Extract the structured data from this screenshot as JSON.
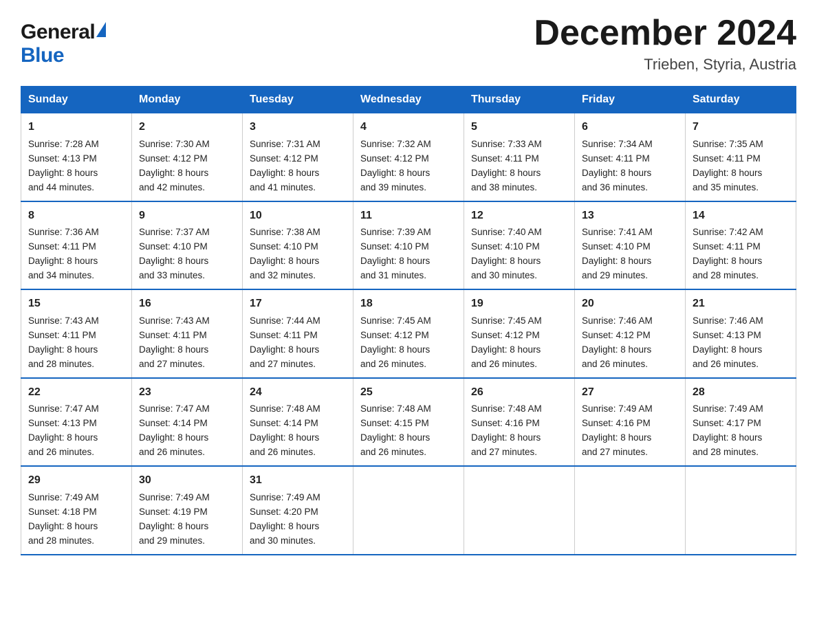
{
  "header": {
    "logo_line1": "General",
    "logo_line2": "Blue",
    "month_title": "December 2024",
    "location": "Trieben, Styria, Austria"
  },
  "days_of_week": [
    "Sunday",
    "Monday",
    "Tuesday",
    "Wednesday",
    "Thursday",
    "Friday",
    "Saturday"
  ],
  "weeks": [
    [
      {
        "day": "1",
        "sunrise": "7:28 AM",
        "sunset": "4:13 PM",
        "daylight": "8 hours and 44 minutes."
      },
      {
        "day": "2",
        "sunrise": "7:30 AM",
        "sunset": "4:12 PM",
        "daylight": "8 hours and 42 minutes."
      },
      {
        "day": "3",
        "sunrise": "7:31 AM",
        "sunset": "4:12 PM",
        "daylight": "8 hours and 41 minutes."
      },
      {
        "day": "4",
        "sunrise": "7:32 AM",
        "sunset": "4:12 PM",
        "daylight": "8 hours and 39 minutes."
      },
      {
        "day": "5",
        "sunrise": "7:33 AM",
        "sunset": "4:11 PM",
        "daylight": "8 hours and 38 minutes."
      },
      {
        "day": "6",
        "sunrise": "7:34 AM",
        "sunset": "4:11 PM",
        "daylight": "8 hours and 36 minutes."
      },
      {
        "day": "7",
        "sunrise": "7:35 AM",
        "sunset": "4:11 PM",
        "daylight": "8 hours and 35 minutes."
      }
    ],
    [
      {
        "day": "8",
        "sunrise": "7:36 AM",
        "sunset": "4:11 PM",
        "daylight": "8 hours and 34 minutes."
      },
      {
        "day": "9",
        "sunrise": "7:37 AM",
        "sunset": "4:10 PM",
        "daylight": "8 hours and 33 minutes."
      },
      {
        "day": "10",
        "sunrise": "7:38 AM",
        "sunset": "4:10 PM",
        "daylight": "8 hours and 32 minutes."
      },
      {
        "day": "11",
        "sunrise": "7:39 AM",
        "sunset": "4:10 PM",
        "daylight": "8 hours and 31 minutes."
      },
      {
        "day": "12",
        "sunrise": "7:40 AM",
        "sunset": "4:10 PM",
        "daylight": "8 hours and 30 minutes."
      },
      {
        "day": "13",
        "sunrise": "7:41 AM",
        "sunset": "4:10 PM",
        "daylight": "8 hours and 29 minutes."
      },
      {
        "day": "14",
        "sunrise": "7:42 AM",
        "sunset": "4:11 PM",
        "daylight": "8 hours and 28 minutes."
      }
    ],
    [
      {
        "day": "15",
        "sunrise": "7:43 AM",
        "sunset": "4:11 PM",
        "daylight": "8 hours and 28 minutes."
      },
      {
        "day": "16",
        "sunrise": "7:43 AM",
        "sunset": "4:11 PM",
        "daylight": "8 hours and 27 minutes."
      },
      {
        "day": "17",
        "sunrise": "7:44 AM",
        "sunset": "4:11 PM",
        "daylight": "8 hours and 27 minutes."
      },
      {
        "day": "18",
        "sunrise": "7:45 AM",
        "sunset": "4:12 PM",
        "daylight": "8 hours and 26 minutes."
      },
      {
        "day": "19",
        "sunrise": "7:45 AM",
        "sunset": "4:12 PM",
        "daylight": "8 hours and 26 minutes."
      },
      {
        "day": "20",
        "sunrise": "7:46 AM",
        "sunset": "4:12 PM",
        "daylight": "8 hours and 26 minutes."
      },
      {
        "day": "21",
        "sunrise": "7:46 AM",
        "sunset": "4:13 PM",
        "daylight": "8 hours and 26 minutes."
      }
    ],
    [
      {
        "day": "22",
        "sunrise": "7:47 AM",
        "sunset": "4:13 PM",
        "daylight": "8 hours and 26 minutes."
      },
      {
        "day": "23",
        "sunrise": "7:47 AM",
        "sunset": "4:14 PM",
        "daylight": "8 hours and 26 minutes."
      },
      {
        "day": "24",
        "sunrise": "7:48 AM",
        "sunset": "4:14 PM",
        "daylight": "8 hours and 26 minutes."
      },
      {
        "day": "25",
        "sunrise": "7:48 AM",
        "sunset": "4:15 PM",
        "daylight": "8 hours and 26 minutes."
      },
      {
        "day": "26",
        "sunrise": "7:48 AM",
        "sunset": "4:16 PM",
        "daylight": "8 hours and 27 minutes."
      },
      {
        "day": "27",
        "sunrise": "7:49 AM",
        "sunset": "4:16 PM",
        "daylight": "8 hours and 27 minutes."
      },
      {
        "day": "28",
        "sunrise": "7:49 AM",
        "sunset": "4:17 PM",
        "daylight": "8 hours and 28 minutes."
      }
    ],
    [
      {
        "day": "29",
        "sunrise": "7:49 AM",
        "sunset": "4:18 PM",
        "daylight": "8 hours and 28 minutes."
      },
      {
        "day": "30",
        "sunrise": "7:49 AM",
        "sunset": "4:19 PM",
        "daylight": "8 hours and 29 minutes."
      },
      {
        "day": "31",
        "sunrise": "7:49 AM",
        "sunset": "4:20 PM",
        "daylight": "8 hours and 30 minutes."
      },
      null,
      null,
      null,
      null
    ]
  ],
  "labels": {
    "sunrise": "Sunrise: ",
    "sunset": "Sunset: ",
    "daylight": "Daylight: "
  }
}
